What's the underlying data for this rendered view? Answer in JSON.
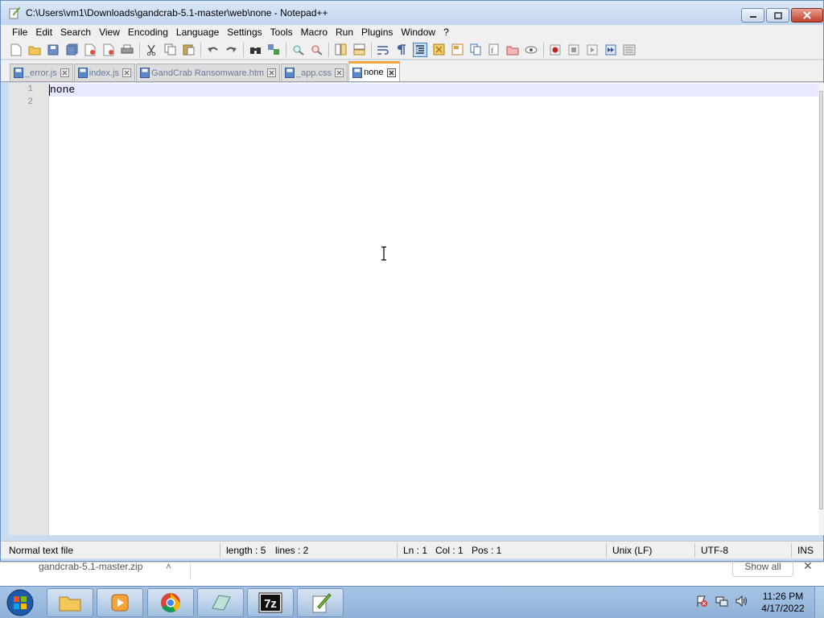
{
  "window": {
    "title": "C:\\Users\\vm1\\Downloads\\gandcrab-5.1-master\\web\\none - Notepad++"
  },
  "menu": [
    "File",
    "Edit",
    "Search",
    "View",
    "Encoding",
    "Language",
    "Settings",
    "Tools",
    "Macro",
    "Run",
    "Plugins",
    "Window",
    "?"
  ],
  "tabs": [
    {
      "label": "_error.js",
      "active": false
    },
    {
      "label": "index.js",
      "active": false
    },
    {
      "label": "GandCrab Ransomware.htm",
      "active": false
    },
    {
      "label": "_app.css",
      "active": false
    },
    {
      "label": "none",
      "active": true
    }
  ],
  "editor": {
    "line_numbers": [
      "1",
      "2"
    ],
    "lines": [
      "none",
      ""
    ]
  },
  "status": {
    "file_type": "Normal text file",
    "length": "length : 5",
    "lines": "lines : 2",
    "ln": "Ln : 1",
    "col": "Col : 1",
    "pos": "Pos : 1",
    "eol": "Unix (LF)",
    "encoding": "UTF-8",
    "mode": "INS"
  },
  "download": {
    "filename": "gandcrab-5.1-master.zip",
    "show_all": "Show all"
  },
  "taskbar": {
    "time": "11:26 PM",
    "date": "4/17/2022"
  },
  "colors": {
    "active_tab_accent": "#f7a43c",
    "current_line": "#e8e8ff",
    "gutter": "#e4e4e4"
  }
}
